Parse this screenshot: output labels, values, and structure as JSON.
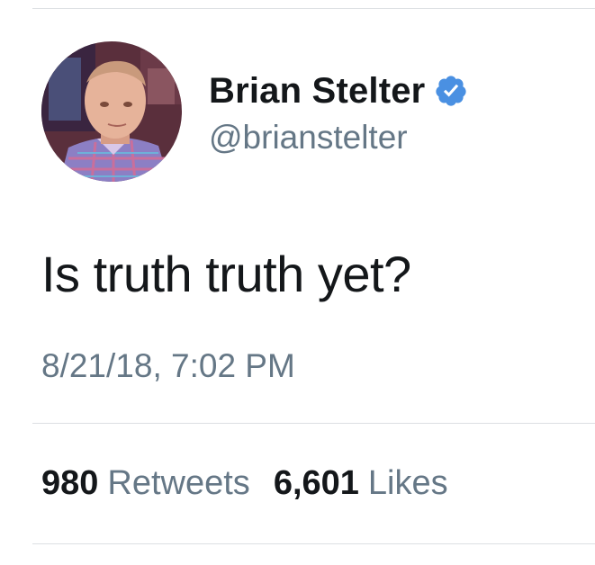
{
  "tweet": {
    "author": {
      "display_name": "Brian Stelter",
      "handle": "@brianstelter",
      "verified": true,
      "verified_color": "#4a90e2"
    },
    "text": "Is truth truth yet?",
    "timestamp": "8/21/18, 7:02 PM",
    "stats": {
      "retweets_count": "980",
      "retweets_label": "Retweets",
      "likes_count": "6,601",
      "likes_label": "Likes"
    }
  },
  "colors": {
    "primary_text": "#14171a",
    "secondary_text": "#657786",
    "divider": "#dcdfe3"
  }
}
